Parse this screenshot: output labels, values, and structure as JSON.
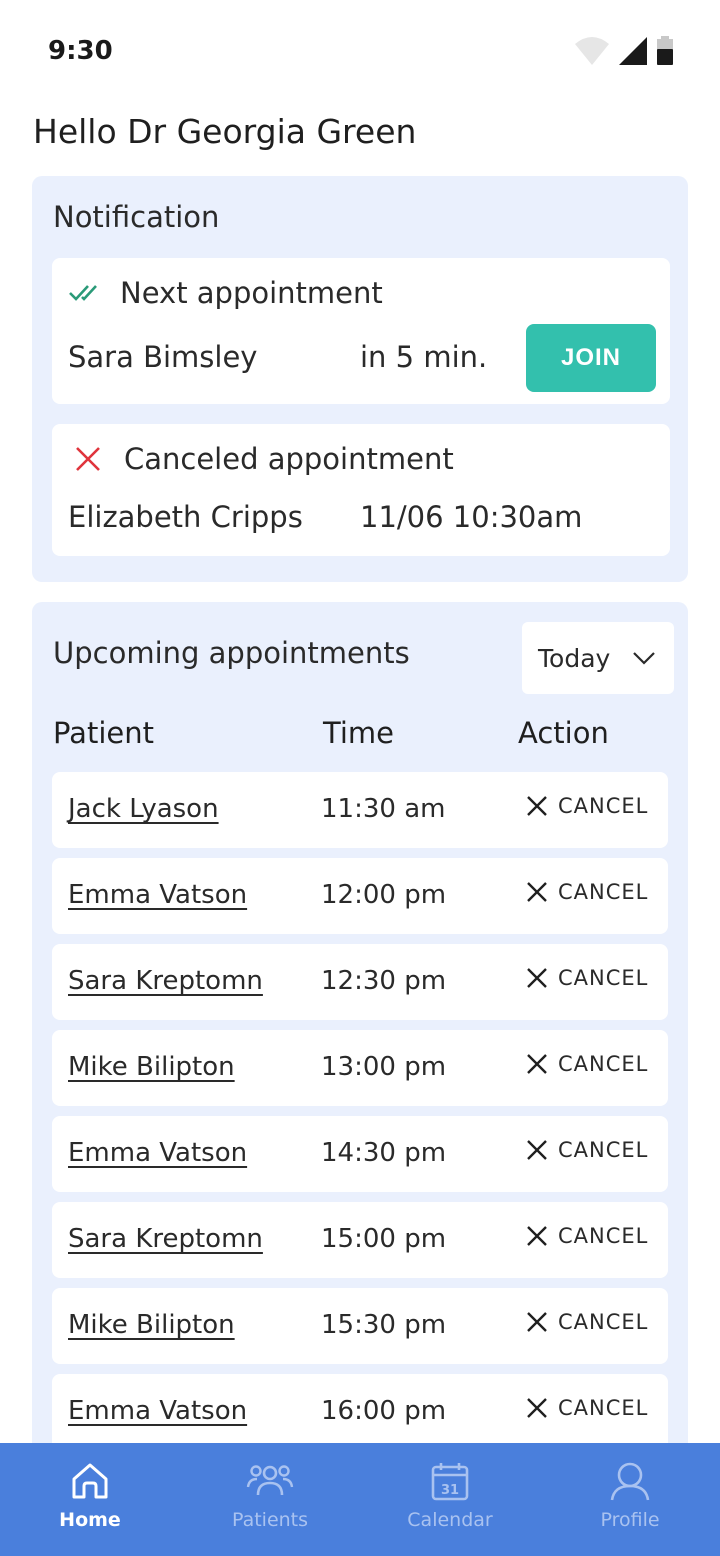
{
  "status": {
    "time": "9:30",
    "icons": [
      "wifi-icon",
      "signal-icon",
      "battery-icon"
    ]
  },
  "greeting": "Hello Dr Georgia Green",
  "notification": {
    "title": "Notification",
    "next": {
      "heading": "Next appointment",
      "patient": "Sara Bimsley",
      "when": "in 5 min.",
      "join_label": "JOIN"
    },
    "canceled": {
      "heading": "Canceled appointment",
      "patient": "Elizabeth Cripps",
      "when": "11/06 10:30am"
    }
  },
  "upcoming": {
    "title": "Upcoming appointments",
    "filter": "Today",
    "columns": {
      "patient": "Patient",
      "time": "Time",
      "action": "Action"
    },
    "rows": [
      {
        "patient": "Jack Lyason",
        "time": "11:30 am",
        "action": "CANCEL"
      },
      {
        "patient": "Emma Vatson",
        "time": "12:00 pm",
        "action": "CANCEL"
      },
      {
        "patient": "Sara Kreptomn",
        "time": "12:30 pm",
        "action": "CANCEL"
      },
      {
        "patient": "Mike Bilipton",
        "time": "13:00 pm",
        "action": "CANCEL"
      },
      {
        "patient": "Emma Vatson",
        "time": "14:30 pm",
        "action": "CANCEL"
      },
      {
        "patient": "Sara Kreptomn",
        "time": "15:00 pm",
        "action": "CANCEL"
      },
      {
        "patient": "Mike Bilipton",
        "time": "15:30 pm",
        "action": "CANCEL"
      },
      {
        "patient": "Emma Vatson",
        "time": "16:00 pm",
        "action": "CANCEL"
      }
    ]
  },
  "nav": [
    {
      "label": "Home",
      "icon": "home-icon",
      "active": true
    },
    {
      "label": "Patients",
      "icon": "patients-icon",
      "active": false
    },
    {
      "label": "Calendar",
      "icon": "calendar-icon",
      "active": false
    },
    {
      "label": "Profile",
      "icon": "profile-icon",
      "active": false
    }
  ],
  "colors": {
    "accent": "#33c0ad",
    "panel": "#eaf0fd",
    "nav": "#4a7fdc",
    "cancel_red": "#e0343c",
    "check_green": "#2a9a78"
  }
}
